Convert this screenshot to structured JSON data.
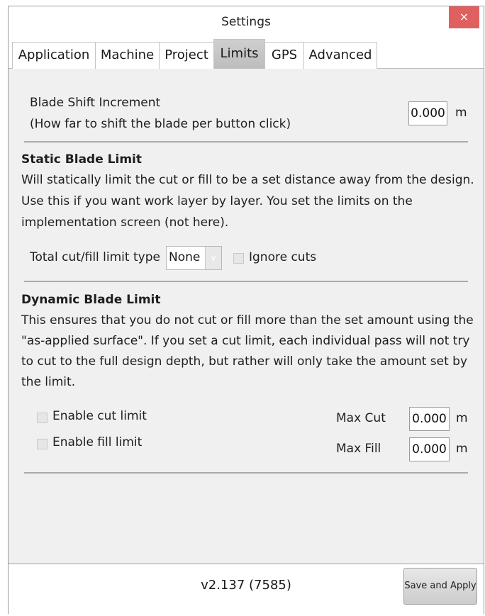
{
  "window": {
    "title": "Settings",
    "close_glyph": "×"
  },
  "tabs": [
    {
      "label": "Application"
    },
    {
      "label": "Machine"
    },
    {
      "label": "Project"
    },
    {
      "label": "Limits",
      "active": true
    },
    {
      "label": "GPS"
    },
    {
      "label": "Advanced"
    }
  ],
  "blade_shift": {
    "title": "Blade Shift Increment",
    "description": "(How far to shift the blade per button click)",
    "value": "0.000",
    "unit": "m"
  },
  "static_limit": {
    "heading": "Static Blade Limit",
    "lines": [
      "Will statically limit the cut or fill to be a set distance away from the design.",
      "Use this if you want work layer by layer. You set the limits on the",
      "implementation screen (not here)."
    ],
    "limit_type_label": "Total cut/fill limit type",
    "limit_type_value": "None",
    "ignore_cuts_label": "Ignore cuts"
  },
  "dynamic_limit": {
    "heading": "Dynamic Blade Limit",
    "lines": [
      "This ensures that you do not cut or fill more than the set amount using the",
      "\"as-applied surface\". If you set a cut limit, each individual pass will not try",
      "to cut to the full design depth, but rather will only take the amount set by",
      "the limit."
    ],
    "enable_cut_label": "Enable cut limit",
    "enable_fill_label": "Enable fill limit",
    "max_cut_label": "Max Cut",
    "max_cut_value": "0.000",
    "max_fill_label": "Max Fill",
    "max_fill_value": "0.000",
    "unit": "m"
  },
  "footer": {
    "version": "v2.137 (7585)",
    "save_label": "Save and Apply"
  },
  "icons": {
    "close": "close-icon",
    "dropdown": "chevron-down-icon"
  },
  "colors": {
    "close_button": "#e0605f",
    "active_tab": "#c6c6c6",
    "panel_bg": "#f0f0f0"
  }
}
